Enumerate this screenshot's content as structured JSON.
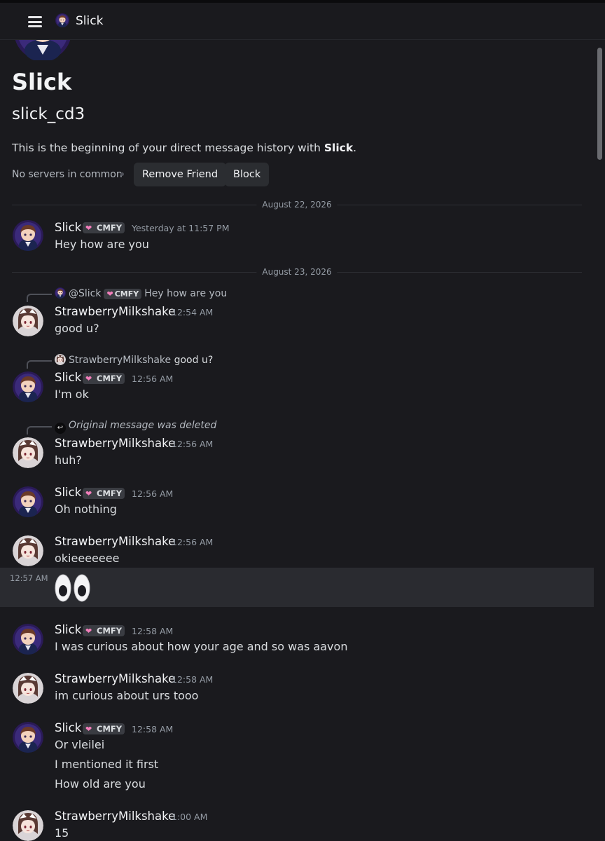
{
  "header": {
    "title": "Slick",
    "menu_icon": "hamburger-menu-icon"
  },
  "profile": {
    "display_name": "Slick",
    "username": "slick_cd3",
    "intro_prefix": "This is the beginning of your direct message history with ",
    "intro_name": "Slick",
    "intro_suffix": ".",
    "mutual": "No servers in common",
    "remove_friend_label": "Remove Friend",
    "block_label": "Block"
  },
  "dividers": [
    "August 22, 2026",
    "August 23, 2026"
  ],
  "tag_label": "CMFY",
  "colors": {
    "background": "#1a1a1e",
    "tag_heart": "#f47fbc",
    "button": "#2b2d31"
  },
  "messages": [
    {
      "author": "Slick",
      "time": "Yesterday at 11:57 PM",
      "lines": [
        "Hey how are you"
      ]
    },
    {
      "author": "StrawberryMilkshake",
      "time": "12:54 AM",
      "reply_to": "@Slick",
      "reply_text": "Hey how are you",
      "lines": [
        "good u?"
      ]
    },
    {
      "author": "Slick",
      "time": "12:56 AM",
      "reply_to": "StrawberryMilkshake",
      "reply_text": "good u?",
      "lines": [
        "I'm ok"
      ]
    },
    {
      "author": "StrawberryMilkshake",
      "time": "12:56 AM",
      "reply_text": "Original message was deleted",
      "lines": [
        "huh?"
      ]
    },
    {
      "author": "Slick",
      "time": "12:56 AM",
      "lines": [
        "Oh nothing"
      ]
    },
    {
      "author": "StrawberryMilkshake",
      "time": "12:56 AM",
      "lines": [
        "okieeeeeee"
      ]
    },
    {
      "author": "StrawberryMilkshake",
      "time": "12:57 AM",
      "emoji": "eyes-emoji"
    },
    {
      "author": "Slick",
      "time": "12:58 AM",
      "lines": [
        "I was curious about how your age and so was aavon"
      ]
    },
    {
      "author": "StrawberryMilkshake",
      "time": "12:58 AM",
      "lines": [
        "im curious about urs tooo"
      ]
    },
    {
      "author": "Slick",
      "time": "12:58 AM",
      "lines": [
        "Or vleilei",
        "I mentioned it first",
        "How old are you"
      ]
    },
    {
      "author": "StrawberryMilkshake",
      "time": "1:00 AM",
      "lines": [
        "15"
      ]
    }
  ]
}
